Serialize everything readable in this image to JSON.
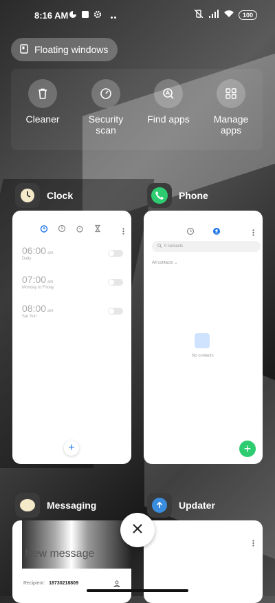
{
  "status_bar": {
    "time": "8:16 AM",
    "battery": "100"
  },
  "floating_windows": {
    "label": "Floating windows"
  },
  "quick_actions": [
    {
      "label": "Cleaner",
      "icon": "trash-icon"
    },
    {
      "label": "Security scan",
      "icon": "shield-check-icon"
    },
    {
      "label": "Find apps",
      "icon": "search-apps-icon"
    },
    {
      "label": "Manage apps",
      "icon": "grid-icon"
    }
  ],
  "apps": {
    "clock": {
      "name": "Clock",
      "alarms": [
        {
          "time": "06:00",
          "ampm": "am",
          "repeat": "Daily"
        },
        {
          "time": "07:00",
          "ampm": "am",
          "repeat": "Monday to Friday"
        },
        {
          "time": "08:00",
          "ampm": "am",
          "repeat": "Sat Sun"
        }
      ]
    },
    "phone": {
      "name": "Phone",
      "search_placeholder": "0 contacts",
      "filter_label": "All contacts",
      "empty_text": "No contacts"
    },
    "messaging": {
      "name": "Messaging",
      "title": "New message",
      "recipient_label": "Recipient:",
      "recipient_number": "18730218809"
    },
    "updater": {
      "name": "Updater"
    }
  },
  "colors": {
    "phone_green": "#2ecc71",
    "updater_blue": "#3a8dde",
    "clock_accent": "#1a73e8"
  }
}
